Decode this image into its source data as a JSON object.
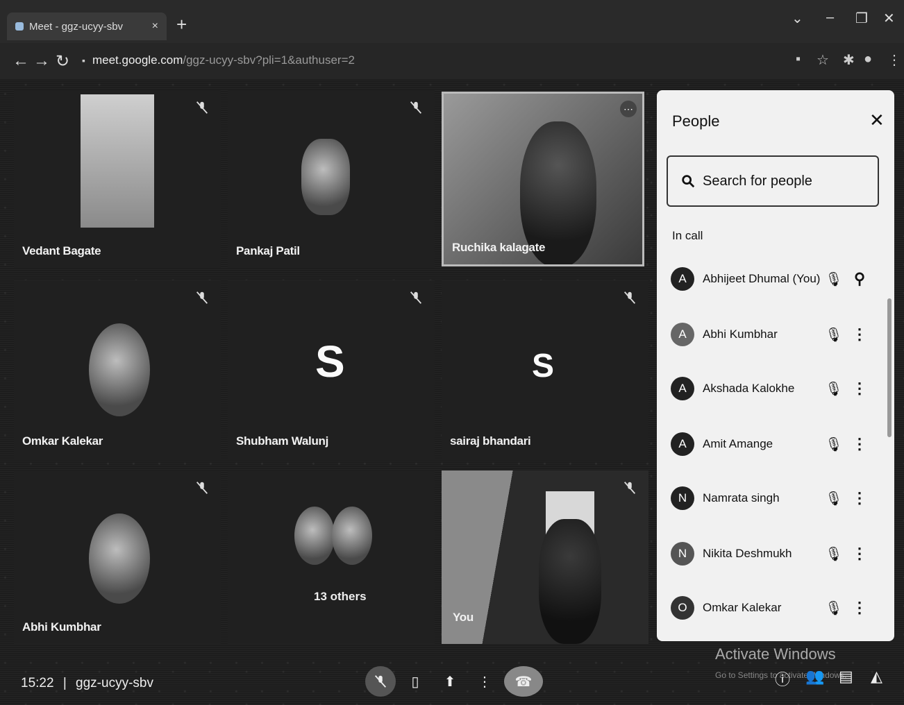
{
  "browser": {
    "tab_title": "Meet - ggz-ucyy-sbv",
    "url_host": "meet.google.com",
    "url_path": "/ggz-ucyy-sbv?pli=1&authuser=2"
  },
  "tiles": [
    {
      "name": "Vedant Bagate"
    },
    {
      "name": "Pankaj Patil"
    },
    {
      "name": "Ruchika kalagate"
    },
    {
      "name": "Omkar Kalekar"
    },
    {
      "name": "Shubham Walunj",
      "initial": "S"
    },
    {
      "name": "sairaj bhandari",
      "initial": "S"
    },
    {
      "name": "Abhi Kumbhar"
    },
    {
      "others_label": "13 others"
    },
    {
      "name": "You"
    }
  ],
  "people_panel": {
    "title": "People",
    "search_placeholder": "Search for people",
    "section_label": "In call",
    "people": [
      {
        "name": "Abhijeet Dhumal (You)",
        "initial": "A"
      },
      {
        "name": "Abhi Kumbhar",
        "initial": "A"
      },
      {
        "name": "Akshada Kalokhe",
        "initial": "A"
      },
      {
        "name": "Amit Amange",
        "initial": "A"
      },
      {
        "name": "Namrata singh",
        "initial": "N"
      },
      {
        "name": "Nikita Deshmukh",
        "initial": "N"
      },
      {
        "name": "Omkar Kalekar",
        "initial": "O"
      }
    ]
  },
  "bottom_bar": {
    "time": "15:22",
    "separator": "|",
    "meeting_code": "ggz-ucyy-sbv"
  },
  "overlay": {
    "activate_title": "Activate Windows",
    "activate_sub": "Go to Settings to activate Windows."
  },
  "colors": {
    "background": "#1d1d1d",
    "panel": "#f1f1f1",
    "end_call": "#c5221f"
  }
}
